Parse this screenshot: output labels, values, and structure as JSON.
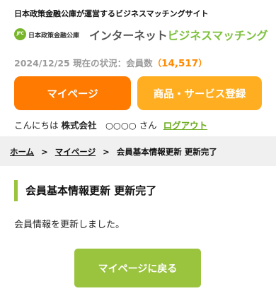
{
  "header": {
    "tagline": "日本政策金融公庫が運営するビジネスマッチングサイト",
    "jfc_mark": "JFC",
    "jfc_name": "日本政策金融公庫",
    "site_name_part1": "インターネット",
    "site_name_part2": "ビジネスマッチング"
  },
  "status": {
    "prefix": "2024/12/25 現在の状況：会員数",
    "open_paren": "（",
    "member_count": "14,517",
    "close_paren": "）"
  },
  "buttons": {
    "mypage": "マイページ",
    "register": "商品・サービス登録"
  },
  "greeting": {
    "hello": "こんにちは",
    "company": "株式会社　○○○○",
    "san": "さん",
    "logout": "ログアウト"
  },
  "breadcrumb": {
    "home": "ホーム",
    "sep": ">",
    "mypage": "マイページ",
    "current": "会員基本情報更新 更新完了"
  },
  "main": {
    "heading": "会員基本情報更新 更新完了",
    "message": "会員情報を更新しました。",
    "back_button": "マイページに戻る"
  },
  "colors": {
    "orange": "#ff7a00",
    "light_orange": "#ffae21",
    "green": "#9ac33e",
    "link_green": "#6aaa1c"
  }
}
